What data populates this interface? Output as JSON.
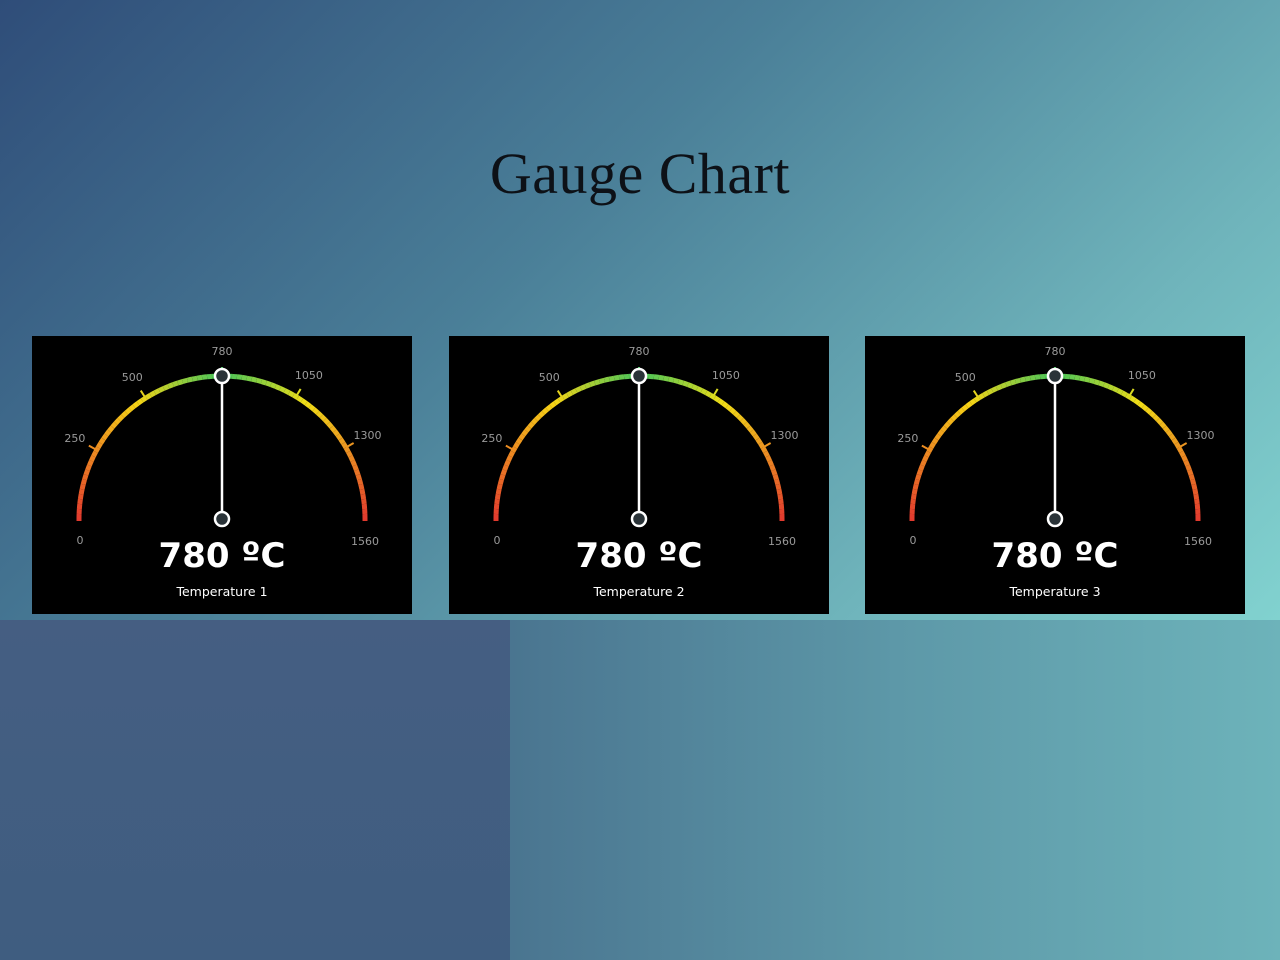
{
  "page": {
    "title": "Gauge Chart"
  },
  "chart_data": [
    {
      "type": "gauge",
      "min": 0,
      "max": 1560,
      "value": 780,
      "value_text": "780 ºC",
      "label": "Temperature 1",
      "ticks": [
        0,
        250,
        500,
        780,
        1050,
        1300,
        1560
      ],
      "colors": {
        "low": "#e23a2e",
        "mid_low": "#f7d516",
        "mid": "#43c55c",
        "mid_high": "#f2de17",
        "high": "#e23a2e"
      }
    },
    {
      "type": "gauge",
      "min": 0,
      "max": 1560,
      "value": 780,
      "value_text": "780 ºC",
      "label": "Temperature 2",
      "ticks": [
        0,
        250,
        500,
        780,
        1050,
        1300,
        1560
      ],
      "colors": {
        "low": "#e23a2e",
        "mid_low": "#f7d516",
        "mid": "#43c55c",
        "mid_high": "#f2de17",
        "high": "#e23a2e"
      }
    },
    {
      "type": "gauge",
      "min": 0,
      "max": 1560,
      "value": 780,
      "value_text": "780 ºC",
      "label": "Temperature 3",
      "ticks": [
        0,
        250,
        500,
        780,
        1050,
        1300,
        1560
      ],
      "colors": {
        "low": "#e23a2e",
        "mid_low": "#f7d516",
        "mid": "#43c55c",
        "mid_high": "#f2de17",
        "high": "#e23a2e"
      }
    }
  ]
}
